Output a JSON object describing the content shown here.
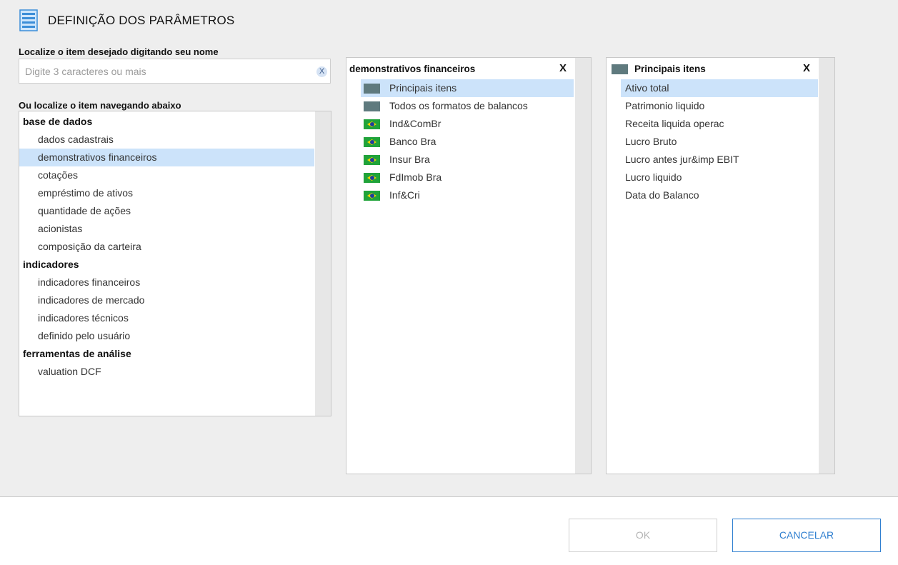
{
  "header": {
    "title": "DEFINIÇÃO DOS PARÂMETROS",
    "icon": "list-form-icon"
  },
  "search": {
    "label": "Localize o item desejado digitando seu nome",
    "placeholder": "Digite 3 caracteres ou mais",
    "value": "",
    "clear_label": "X"
  },
  "browse": {
    "label": "Ou localize o item navegando abaixo",
    "sections": [
      {
        "title": "base de dados",
        "items": [
          "dados cadastrais",
          "demonstrativos financeiros",
          "cotações",
          "empréstimo de ativos",
          "quantidade de ações",
          "acionistas",
          "composição da carteira"
        ]
      },
      {
        "title": "indicadores",
        "items": [
          "indicadores financeiros",
          "indicadores de mercado",
          "indicadores técnicos",
          "definido pelo usuário"
        ]
      },
      {
        "title": "ferramentas de análise",
        "items": [
          "valuation DCF"
        ]
      }
    ],
    "selected": "demonstrativos financeiros"
  },
  "middle_panel": {
    "title": "demonstrativos financeiros",
    "close_label": "X",
    "items": [
      {
        "label": "Principais itens",
        "icon": "gray-square-icon"
      },
      {
        "label": "Todos os formatos de balancos",
        "icon": "gray-square-icon"
      },
      {
        "label": "Ind&ComBr",
        "icon": "brazil-flag-icon"
      },
      {
        "label": "Banco Bra",
        "icon": "brazil-flag-icon"
      },
      {
        "label": "Insur Bra",
        "icon": "brazil-flag-icon"
      },
      {
        "label": "FdImob Bra",
        "icon": "brazil-flag-icon"
      },
      {
        "label": "Inf&Cri",
        "icon": "brazil-flag-icon"
      }
    ],
    "selected": "Principais itens"
  },
  "right_panel": {
    "title": "Principais itens",
    "icon": "gray-square-icon",
    "close_label": "X",
    "items": [
      "Ativo total",
      "Patrimonio liquido",
      "Receita liquida operac",
      "Lucro Bruto",
      "Lucro antes jur&imp EBIT",
      "Lucro liquido",
      "Data do Balanco"
    ],
    "selected": "Ativo total"
  },
  "footer": {
    "ok_label": "OK",
    "cancel_label": "CANCELAR"
  },
  "colors": {
    "selection": "#cce3fa",
    "accent": "#2f7fd0",
    "panel_bg": "#eeeeee"
  }
}
